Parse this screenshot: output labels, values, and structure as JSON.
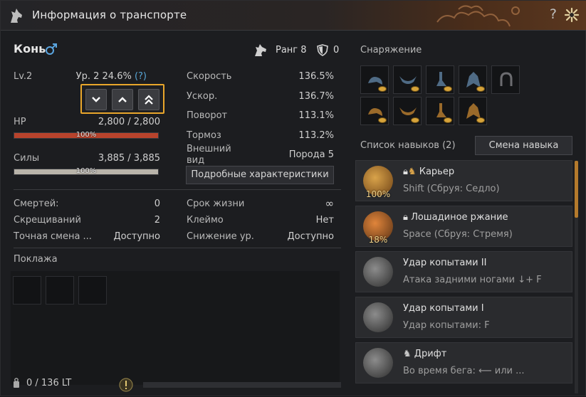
{
  "window": {
    "title": "Информация о транспорте",
    "help_label": "?",
    "accent": "#e9a62b"
  },
  "horse": {
    "name": "Конь",
    "rank_label": "Ранг 8",
    "shield_value": "0"
  },
  "level": {
    "label": "Lv.2",
    "value": "Ур. 2 24.6%",
    "help": "(?)"
  },
  "hp": {
    "label": "HP",
    "value": "2,800 / 2,800",
    "bar_text": "100%",
    "fraction": 1.0,
    "color": "#b8432c"
  },
  "stamina": {
    "label": "Силы",
    "value": "3,885 / 3,885",
    "bar_text": "100%",
    "fraction": 1.0,
    "color": "#b9b4aa"
  },
  "stats": [
    {
      "label": "Скорость",
      "value": "136.5%"
    },
    {
      "label": "Ускор.",
      "value": "136.7%"
    },
    {
      "label": "Поворот",
      "value": "113.1%"
    },
    {
      "label": "Тормоз",
      "value": "113.2%"
    },
    {
      "label": "Внешний вид",
      "value": "Порода 5"
    }
  ],
  "detail_button": "Подробные характеристики",
  "info_left": [
    {
      "label": "Смертей:",
      "value": "0"
    },
    {
      "label": "Скрещиваний",
      "value": "2"
    },
    {
      "label": "Точная смена ...",
      "value": "Доступно"
    }
  ],
  "info_right": [
    {
      "label": "Срок жизни",
      "value": "∞"
    },
    {
      "label": "Клеймо",
      "value": "Нет"
    },
    {
      "label": "Снижение ур.",
      "value": "Доступно"
    }
  ],
  "cargo": {
    "title": "Поклажа",
    "weight": "0 / 136 LT"
  },
  "equipment": {
    "title": "Снаряжение"
  },
  "skills": {
    "title": "Список навыков (2)",
    "change_button": "Смена навыка",
    "items": [
      {
        "name": "Карьер",
        "desc": "Shift (Сбруя: Седло)",
        "percent": "100%"
      },
      {
        "name": "Лошадиное ржание",
        "desc": "Space (Сбруя: Стремя)",
        "percent": "18%"
      },
      {
        "name": "Удар копытами II",
        "desc": "Атака задними ногами ↓+ F",
        "percent": ""
      },
      {
        "name": "Удар копытами I",
        "desc": "Удар копытами: F",
        "percent": ""
      },
      {
        "name": "Дрифт",
        "desc": "Во время бега: ⟵ или ...",
        "percent": ""
      }
    ]
  }
}
